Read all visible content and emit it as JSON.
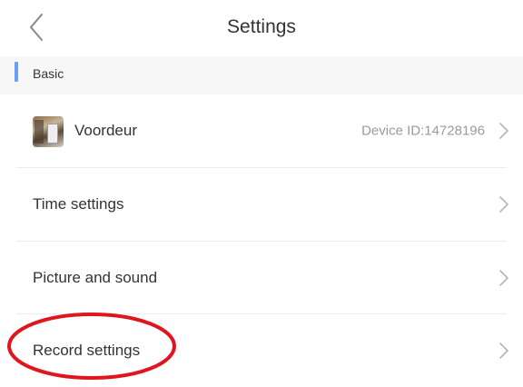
{
  "header": {
    "title": "Settings",
    "back_icon": "chevron-left-icon"
  },
  "section": {
    "label": "Basic",
    "accent_color": "#6aa0f4"
  },
  "rows": [
    {
      "label": "Voordeur",
      "detail": "Device ID:14728196",
      "icon": "device-thumbnail"
    },
    {
      "label": "Time settings"
    },
    {
      "label": "Picture and sound"
    },
    {
      "label": "Record settings"
    }
  ],
  "annotation": {
    "shape": "ellipse",
    "color": "#e0151d",
    "target": "Record settings"
  }
}
